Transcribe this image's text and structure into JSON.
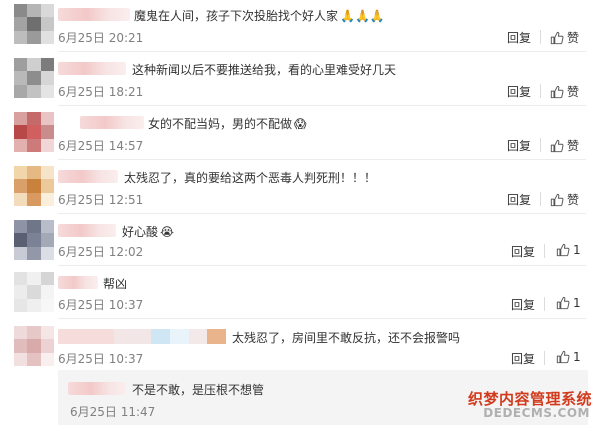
{
  "labels": {
    "reply": "回复",
    "like": "赞"
  },
  "comments": [
    {
      "text": "魔鬼在人间，孩子下次投胎找个好人家",
      "emoji": "🙏🙏🙏",
      "time": "6月25日 20:21",
      "like": "赞"
    },
    {
      "text": "这种新闻以后不要推送给我，看的心里难受好几天",
      "emoji": "",
      "time": "6月25日 18:21",
      "like": "赞"
    },
    {
      "text": "女的不配当妈，男的不配做",
      "emoji": "😱",
      "time": "6月25日 14:57",
      "like": "赞"
    },
    {
      "text": "太残忍了，真的要给这两个恶毒人判死刑！！！",
      "emoji": "",
      "time": "6月25日 12:51",
      "like": "赞"
    },
    {
      "text": "好心酸",
      "emoji": "😭",
      "time": "6月25日 12:02",
      "like": "1"
    },
    {
      "text": "帮凶",
      "emoji": "",
      "time": "6月25日 10:37",
      "like": "1"
    },
    {
      "text": "太残忍了，房间里不敢反抗，还不会报警吗",
      "emoji": "",
      "time": "6月25日 10:37",
      "like": "1"
    }
  ],
  "subreply": {
    "text": "不是不敢，是压根不想管",
    "time": "6月25日 11:47"
  },
  "watermark": {
    "line1": "织梦内容管理系统",
    "line2": "DEDECMS.COM"
  },
  "colors": {
    "time": "#808080",
    "text": "#333333",
    "watermark_red": "#d23a1c",
    "subreply_bg": "#f4f4f4"
  }
}
